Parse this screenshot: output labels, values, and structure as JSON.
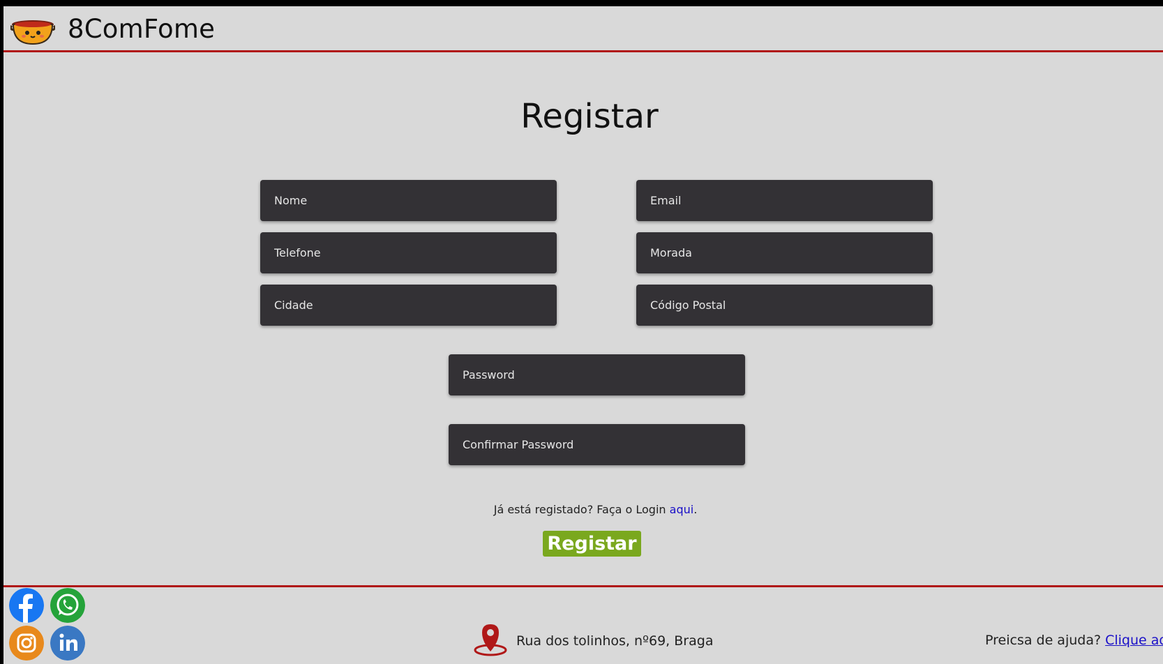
{
  "header": {
    "brand": "8ComFome",
    "logo_icon": "pot-mascot-icon"
  },
  "form": {
    "title": "Registar",
    "fields": {
      "nome": "Nome",
      "email": "Email",
      "telefone": "Telefone",
      "morada": "Morada",
      "cidade": "Cidade",
      "codigo_postal": "Código Postal",
      "password": "Password",
      "confirmar_password": "Confirmar Password"
    },
    "login_prompt": "Já está registado? Faça o Login ",
    "login_link": "aqui",
    "login_suffix": ".",
    "submit_label": "Registar"
  },
  "footer": {
    "social": [
      "facebook-icon",
      "whatsapp-icon",
      "instagram-icon",
      "linkedin-icon"
    ],
    "address": "Rua dos tolinhos, nº69, Braga",
    "help_prompt": "Preicsa de ajuda? ",
    "help_link": "Clique aqui"
  },
  "colors": {
    "background": "#d9d9d9",
    "accent_line": "#b01818",
    "field_bg": "#333135",
    "button_bg": "#7aa81e",
    "link": "#1a10c8"
  }
}
